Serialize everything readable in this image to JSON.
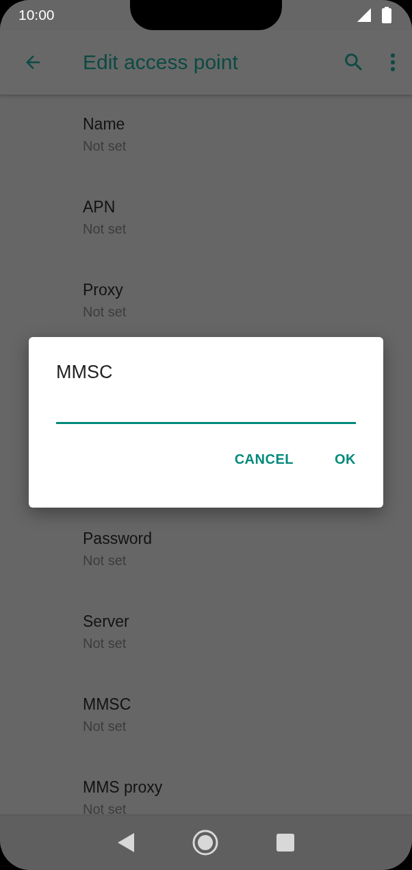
{
  "status_bar": {
    "time": "10:00"
  },
  "app_bar": {
    "title": "Edit access point"
  },
  "settings": [
    {
      "title": "Name",
      "summary": "Not set"
    },
    {
      "title": "APN",
      "summary": "Not set"
    },
    {
      "title": "Proxy",
      "summary": "Not set"
    },
    {
      "title": "Password",
      "summary": "Not set"
    },
    {
      "title": "Server",
      "summary": "Not set"
    },
    {
      "title": "MMSC",
      "summary": "Not set"
    },
    {
      "title": "MMS proxy",
      "summary": "Not set"
    }
  ],
  "dialog": {
    "title": "MMSC",
    "buttons": [
      "CANCEL",
      "OK"
    ]
  }
}
